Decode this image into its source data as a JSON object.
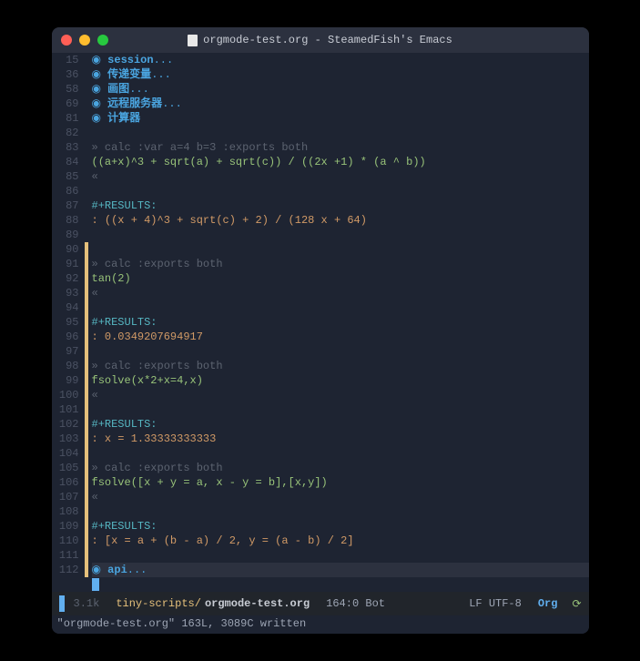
{
  "window": {
    "title": "orgmode-test.org - SteamedFish's Emacs"
  },
  "headings": [
    {
      "ln": "15",
      "bullet": "◉",
      "text": "session",
      "ellipsis": "..."
    },
    {
      "ln": "36",
      "bullet": "◉",
      "text": "传递变量",
      "ellipsis": "..."
    },
    {
      "ln": "58",
      "bullet": "◉",
      "text": "画图",
      "ellipsis": "..."
    },
    {
      "ln": "69",
      "bullet": "◉",
      "text": "远程服务器",
      "ellipsis": "..."
    },
    {
      "ln": "81",
      "bullet": "◉",
      "text": "计算器",
      "ellipsis": ""
    }
  ],
  "body": [
    {
      "ln": "82",
      "type": "blank",
      "text": ""
    },
    {
      "ln": "83",
      "type": "begin",
      "text": "» calc :var a=4 b=3 :exports both"
    },
    {
      "ln": "84",
      "type": "code",
      "text": "((a+x)^3 + sqrt(a) + sqrt(c)) / ((2x +1) * (a ^ b))"
    },
    {
      "ln": "85",
      "type": "end",
      "text": "«"
    },
    {
      "ln": "86",
      "type": "blank",
      "text": ""
    },
    {
      "ln": "87",
      "type": "results",
      "text": "#+RESULTS:"
    },
    {
      "ln": "88",
      "type": "resval",
      "text": ": ((x + 4)^3 + sqrt(c) + 2) / (128 x + 64)"
    },
    {
      "ln": "89",
      "type": "blank",
      "text": ""
    },
    {
      "ln": "90",
      "type": "blank",
      "text": "",
      "mod": true
    },
    {
      "ln": "91",
      "type": "begin",
      "text": "» calc :exports both",
      "mod": true
    },
    {
      "ln": "92",
      "type": "code",
      "text": "tan(2)",
      "mod": true
    },
    {
      "ln": "93",
      "type": "end",
      "text": "«",
      "mod": true
    },
    {
      "ln": "94",
      "type": "blank",
      "text": "",
      "mod": true
    },
    {
      "ln": "95",
      "type": "results",
      "text": "#+RESULTS:",
      "mod": true
    },
    {
      "ln": "96",
      "type": "resval",
      "text": ": 0.0349207694917",
      "mod": true
    },
    {
      "ln": "97",
      "type": "blank",
      "text": "",
      "mod": true
    },
    {
      "ln": "98",
      "type": "begin",
      "text": "» calc :exports both",
      "mod": true
    },
    {
      "ln": "99",
      "type": "code",
      "text": "fsolve(x*2+x=4,x)",
      "mod": true
    },
    {
      "ln": "100",
      "type": "end",
      "text": "«",
      "mod": true
    },
    {
      "ln": "101",
      "type": "blank",
      "text": "",
      "mod": true
    },
    {
      "ln": "102",
      "type": "results",
      "text": "#+RESULTS:",
      "mod": true
    },
    {
      "ln": "103",
      "type": "resval",
      "text": ": x = 1.33333333333",
      "mod": true
    },
    {
      "ln": "104",
      "type": "blank",
      "text": "",
      "mod": true
    },
    {
      "ln": "105",
      "type": "begin",
      "text": "» calc :exports both",
      "mod": true
    },
    {
      "ln": "106",
      "type": "code",
      "text": "fsolve([x + y = a, x - y = b],[x,y])",
      "mod": true
    },
    {
      "ln": "107",
      "type": "end",
      "text": "«",
      "mod": true
    },
    {
      "ln": "108",
      "type": "blank",
      "text": "",
      "mod": true
    },
    {
      "ln": "109",
      "type": "results",
      "text": "#+RESULTS:",
      "mod": true
    },
    {
      "ln": "110",
      "type": "resval",
      "text": ": [x = a + (b - a) / 2, y = (a - b) / 2]",
      "mod": true
    },
    {
      "ln": "111",
      "type": "blank",
      "text": "",
      "mod": true
    }
  ],
  "final_heading": {
    "ln": "112",
    "bullet": "◉",
    "text": "api",
    "ellipsis": "...",
    "mod": true
  },
  "cursor_row": {
    "text": ""
  },
  "modeline": {
    "size": "3.1k",
    "project": "tiny-scripts/",
    "file": "orgmode-test.org",
    "pos": "164:0 Bot",
    "encoding": "LF UTF-8",
    "mode": "Org",
    "git_icon": "⟳"
  },
  "echo": "\"orgmode-test.org\" 163L, 3089C written"
}
